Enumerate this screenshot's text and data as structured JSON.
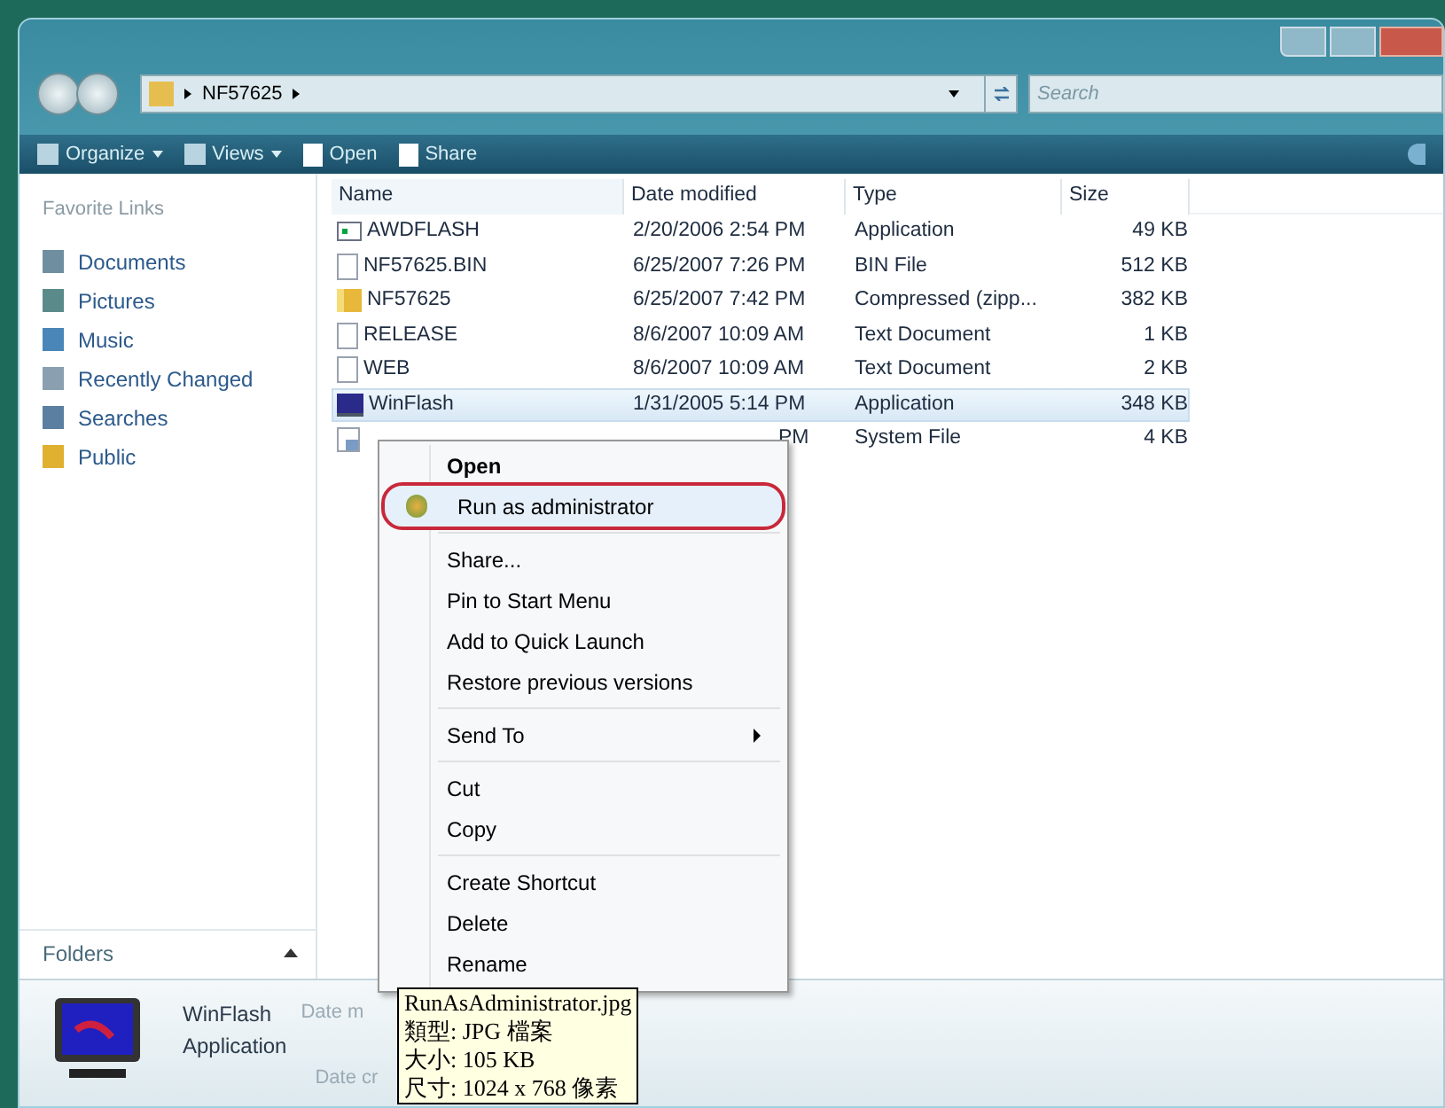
{
  "address_bar": {
    "breadcrumb": [
      "NF57625"
    ],
    "search": {
      "placeholder": "Search"
    }
  },
  "toolbar": [
    {
      "label": "Organize",
      "kind": "dropdown"
    },
    {
      "label": "Views",
      "kind": "dropdown"
    },
    {
      "label": "Open",
      "kind": "button"
    },
    {
      "label": "Share",
      "kind": "button"
    }
  ],
  "sidebar": {
    "heading": "Favorite Links",
    "items": [
      {
        "label": "Documents"
      },
      {
        "label": "Pictures"
      },
      {
        "label": "Music"
      },
      {
        "label": "Recently Changed"
      },
      {
        "label": "Searches"
      },
      {
        "label": "Public"
      }
    ],
    "folders": "Folders"
  },
  "table": {
    "columns": [
      "Name",
      "Date modified",
      "Type",
      "Size"
    ],
    "rows": [
      {
        "name": "AWDFLASH",
        "date": "2/20/2006 2:54 PM",
        "type": "Application",
        "size": "49 KB",
        "kind": "app",
        "selected": false
      },
      {
        "name": "NF57625.BIN",
        "date": "6/25/2007 7:26 PM",
        "type": "BIN File",
        "size": "512 KB",
        "kind": "file",
        "selected": false
      },
      {
        "name": "NF57625",
        "date": "6/25/2007 7:42 PM",
        "type": "Compressed (zipp...",
        "size": "382 KB",
        "kind": "zip",
        "selected": false
      },
      {
        "name": "RELEASE",
        "date": "8/6/2007 10:09 AM",
        "type": "Text Document",
        "size": "1 KB",
        "kind": "file",
        "selected": false
      },
      {
        "name": "WEB",
        "date": "8/6/2007 10:09 AM",
        "type": "Text Document",
        "size": "2 KB",
        "kind": "file",
        "selected": false
      },
      {
        "name": "WinFlash",
        "date": "1/31/2005 5:14 PM",
        "type": "Application",
        "size": "348 KB",
        "kind": "winflash",
        "selected": true
      },
      {
        "date": "PM",
        "type": "System File",
        "size": "4 KB",
        "kind": "sys",
        "selected": false
      }
    ]
  },
  "context_menu": {
    "groups": [
      [
        {
          "label": "Open",
          "default": true,
          "highlighted": false,
          "submenu": false
        },
        {
          "label": "Run as administrator",
          "default": false,
          "highlighted": true,
          "submenu": false
        }
      ],
      [
        {
          "label": "Share...",
          "default": false,
          "highlighted": false,
          "submenu": false
        },
        {
          "label": "Pin to Start Menu",
          "default": false,
          "highlighted": false,
          "submenu": false
        },
        {
          "label": "Add to Quick Launch",
          "default": false,
          "highlighted": false,
          "submenu": false
        },
        {
          "label": "Restore previous versions",
          "default": false,
          "highlighted": false,
          "submenu": false
        }
      ],
      [
        {
          "label": "Send To",
          "default": false,
          "highlighted": false,
          "submenu": true
        }
      ],
      [
        {
          "label": "Cut",
          "default": false,
          "highlighted": false,
          "submenu": false
        },
        {
          "label": "Copy",
          "default": false,
          "highlighted": false,
          "submenu": false
        }
      ],
      [
        {
          "label": "Create Shortcut",
          "default": false,
          "highlighted": false,
          "submenu": false
        },
        {
          "label": "Delete",
          "default": false,
          "highlighted": false,
          "submenu": false
        },
        {
          "label": "Rename",
          "default": false,
          "highlighted": false,
          "submenu": false
        }
      ]
    ]
  },
  "details_pane": {
    "name": "WinFlash",
    "type": "Application",
    "labels": [
      "Date m",
      "Date cr"
    ]
  },
  "tooltip": [
    "RunAsAdministrator.jpg",
    "類型: JPG 檔案",
    "大小: 105 KB",
    "尺寸: 1024 x 768 像素"
  ]
}
